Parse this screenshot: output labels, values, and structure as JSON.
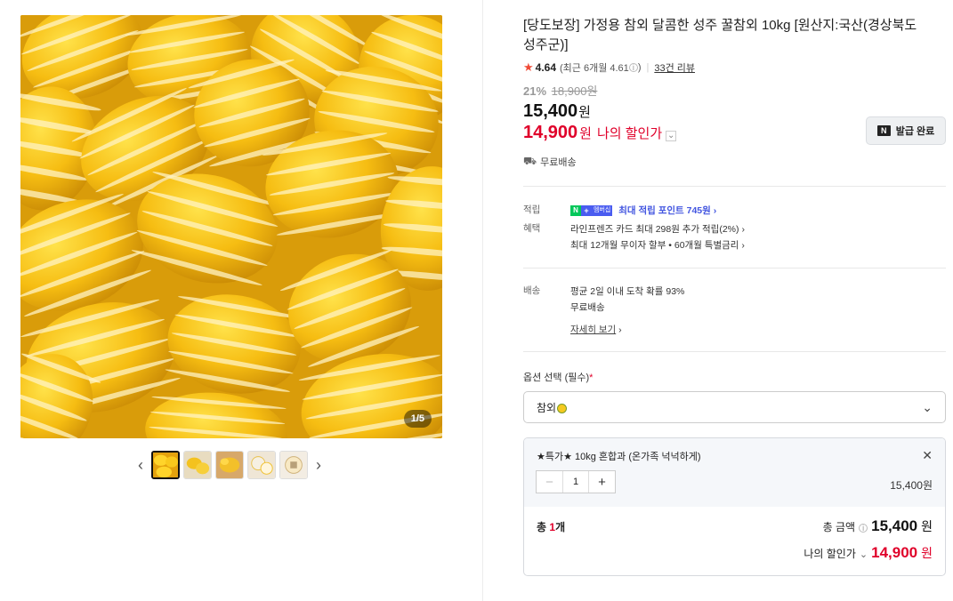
{
  "gallery": {
    "counter": "1/5",
    "prev_icon": "‹",
    "next_icon": "›",
    "thumb_count": 5
  },
  "product": {
    "title": "[당도보장] 가정용 참외 달콤한 성주 꿀참외 10kg [원산지:국산(경상북도 성주군)]",
    "rating": "4.64",
    "rating_recent": "(최근 6개월 4.61",
    "rating_recent_close": ")",
    "reviews": "33건 리뷰",
    "discount_pct": "21%",
    "original_price": "18,900원",
    "price": "15,400",
    "price_unit": "원",
    "my_price": "14,900",
    "my_price_unit": "원",
    "my_price_label": "나의 할인가",
    "coupon_button": "발급 완료",
    "shipping": "무료배송"
  },
  "benefits": {
    "points_label": "적립",
    "points_badge_text": "멤버십",
    "points_text": "최대 적립 포인트 745원",
    "benefit_label": "혜택",
    "benefit_line1": "라인프렌즈 카드 최대 298원 추가 적립(2%)",
    "benefit_line2": "최대 12개월 무이자 할부 • 60개월 특별금리"
  },
  "delivery": {
    "label": "배송",
    "line1": "평균 2일 이내 도착 확률 93%",
    "line2": "무료배송",
    "more_link": "자세히 보기"
  },
  "options": {
    "label": "옵션 선택 (필수)",
    "required_mark": "*",
    "selected_value": "참외"
  },
  "selection": {
    "item_name": "★특가★ 10kg 혼합과 (온가족 넉넉하게)",
    "quantity": "1",
    "item_price": "15,400원",
    "total_count_prefix": "총 ",
    "total_count_num": "1",
    "total_count_suffix": "개",
    "total_label": "총 금액",
    "total_value": "15,400",
    "total_unit": "원",
    "my_total_label": "나의 할인가",
    "my_total_value": "14,900",
    "my_total_unit": "원"
  },
  "colors": {
    "accent_red": "#e0002a",
    "naver_green": "#03c75a",
    "point_blue": "#4255e0",
    "melon_yellow": "#f7c21d"
  }
}
